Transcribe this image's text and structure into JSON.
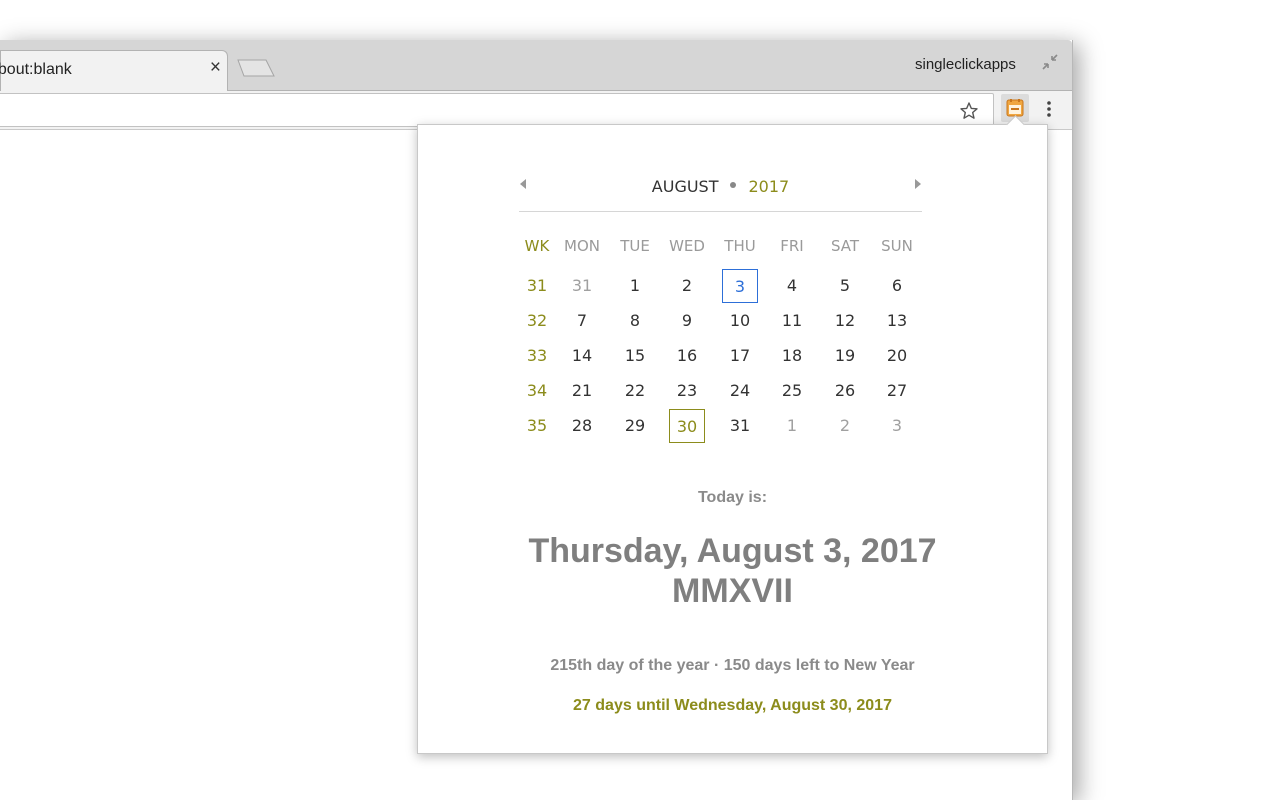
{
  "browser": {
    "tab_title": "about:blank",
    "tab_close": "×",
    "profile_name": "singleclickapps"
  },
  "calendar": {
    "month": "AUGUST",
    "year": "2017",
    "headers": [
      "WK",
      "MON",
      "TUE",
      "WED",
      "THU",
      "FRI",
      "SAT",
      "SUN"
    ],
    "weeks": [
      {
        "wk": "31",
        "days": [
          {
            "d": "31",
            "other": true
          },
          {
            "d": "1"
          },
          {
            "d": "2"
          },
          {
            "d": "3",
            "today": true
          },
          {
            "d": "4"
          },
          {
            "d": "5"
          },
          {
            "d": "6"
          }
        ]
      },
      {
        "wk": "32",
        "days": [
          {
            "d": "7"
          },
          {
            "d": "8"
          },
          {
            "d": "9"
          },
          {
            "d": "10"
          },
          {
            "d": "11"
          },
          {
            "d": "12"
          },
          {
            "d": "13"
          }
        ]
      },
      {
        "wk": "33",
        "days": [
          {
            "d": "14"
          },
          {
            "d": "15"
          },
          {
            "d": "16"
          },
          {
            "d": "17"
          },
          {
            "d": "18"
          },
          {
            "d": "19"
          },
          {
            "d": "20"
          }
        ]
      },
      {
        "wk": "34",
        "days": [
          {
            "d": "21"
          },
          {
            "d": "22"
          },
          {
            "d": "23"
          },
          {
            "d": "24"
          },
          {
            "d": "25"
          },
          {
            "d": "26"
          },
          {
            "d": "27"
          }
        ]
      },
      {
        "wk": "35",
        "days": [
          {
            "d": "28"
          },
          {
            "d": "29"
          },
          {
            "d": "30",
            "target": true
          },
          {
            "d": "31"
          },
          {
            "d": "1",
            "other": true
          },
          {
            "d": "2",
            "other": true
          },
          {
            "d": "3",
            "other": true
          }
        ]
      }
    ]
  },
  "info": {
    "today_label": "Today is:",
    "full_date": "Thursday, August 3, 2017",
    "roman_year": "MMXVII",
    "day_of_year": "215th day of the year · 150 days left to New Year",
    "countdown": "27 days until Wednesday, August 30, 2017"
  },
  "colors": {
    "accent": "#8c8c1c",
    "today_border": "#2d6fd8",
    "muted_text": "#8a8a8a"
  },
  "icons": [
    "close-icon",
    "new-tab-icon",
    "shrink-icon",
    "star-icon",
    "calendar-extension-icon",
    "menu-icon",
    "chevron-left-icon",
    "chevron-right-icon"
  ]
}
